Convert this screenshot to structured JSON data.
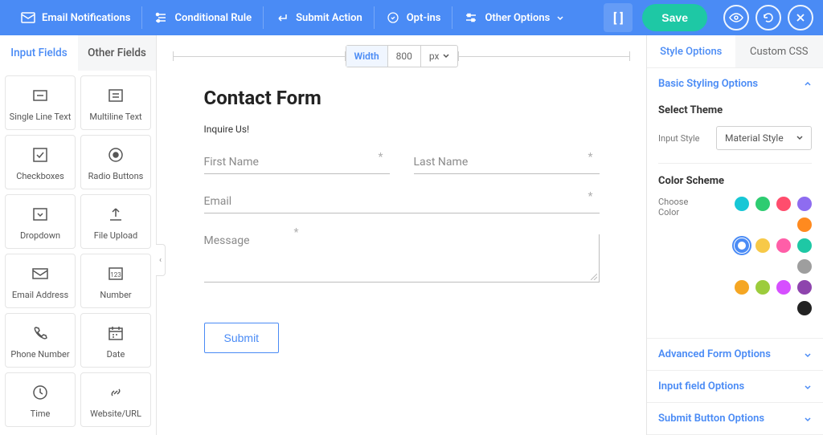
{
  "topbar": {
    "items": [
      {
        "label": "Email Notifications"
      },
      {
        "label": "Conditional Rule"
      },
      {
        "label": "Submit Action"
      },
      {
        "label": "Opt-ins"
      },
      {
        "label": "Other Options"
      }
    ],
    "bracket": "[ ]",
    "save": "Save"
  },
  "left": {
    "tabs": {
      "input": "Input Fields",
      "other": "Other Fields"
    },
    "fields": [
      [
        "Single Line Text",
        "Multiline Text"
      ],
      [
        "Checkboxes",
        "Radio Buttons"
      ],
      [
        "Dropdown",
        "File Upload"
      ],
      [
        "Email Address",
        "Number"
      ],
      [
        "Phone Number",
        "Date"
      ],
      [
        "Time",
        "Website/URL"
      ]
    ]
  },
  "center": {
    "width_label": "Width",
    "width_value": "800",
    "width_unit": "px",
    "form_title": "Contact Form",
    "inquire": "Inquire Us!",
    "first_name": "First Name",
    "last_name": "Last Name",
    "email": "Email",
    "message": "Message",
    "submit": "Submit"
  },
  "right": {
    "tabs": {
      "style": "Style Options",
      "css": "Custom CSS"
    },
    "basic": "Basic Styling Options",
    "select_theme": "Select Theme",
    "input_style_label": "Input Style",
    "input_style_value": "Material Style",
    "color_scheme": "Color Scheme",
    "choose_color": "Choose Color",
    "colors_row1": [
      "#17c7d6",
      "#2ecc71",
      "#ff4d6d",
      "#8e6cf0",
      "#ff8a1f"
    ],
    "colors_row2": [
      "#4a8bf5",
      "#f7c948",
      "#ff5ea8",
      "#1ec8a5",
      "#9e9e9e"
    ],
    "colors_row3": [
      "#f5a623",
      "#9ccc3c",
      "#d64fff",
      "#8e44ad",
      "#222222"
    ],
    "advanced": "Advanced Form Options",
    "input_opts": "Input field Options",
    "submit_opts": "Submit Button Options"
  }
}
